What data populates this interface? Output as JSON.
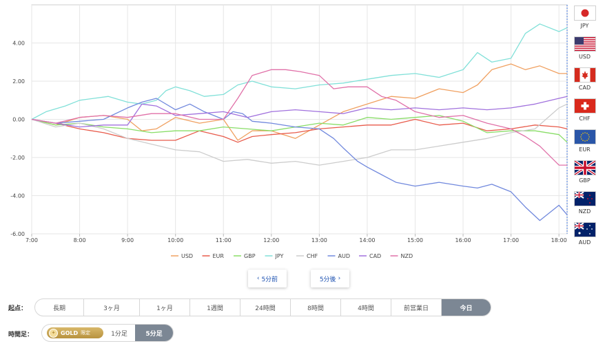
{
  "chart_data": {
    "type": "line",
    "x_ticks": [
      "7:00",
      "8:00",
      "9:00",
      "10:00",
      "11:00",
      "12:00",
      "13:00",
      "14:00",
      "15:00",
      "16:00",
      "17:00",
      "18:00"
    ],
    "y_ticks": [
      "4.00",
      "2.00",
      "0.00",
      "-2.00",
      "-4.00",
      "-6.00"
    ],
    "xlim": [
      7.0,
      18.17
    ],
    "ylim": [
      -6.0,
      6.0
    ],
    "grid": true,
    "legend_position": "bottom",
    "series": [
      {
        "name": "USD",
        "color": "#f0a060",
        "points": [
          [
            7,
            0
          ],
          [
            7.5,
            -0.3
          ],
          [
            8,
            0.1
          ],
          [
            8.5,
            0.2
          ],
          [
            9,
            0
          ],
          [
            9.3,
            -0.6
          ],
          [
            9.6,
            -0.5
          ],
          [
            10,
            0.1
          ],
          [
            10.5,
            -0.2
          ],
          [
            11,
            0
          ],
          [
            11.3,
            -1.1
          ],
          [
            11.6,
            -0.6
          ],
          [
            12,
            -0.6
          ],
          [
            12.5,
            -1.0
          ],
          [
            13,
            -0.3
          ],
          [
            13.5,
            0.4
          ],
          [
            14,
            0.8
          ],
          [
            14.5,
            1.2
          ],
          [
            15,
            1.1
          ],
          [
            15.5,
            1.6
          ],
          [
            16,
            1.4
          ],
          [
            16.3,
            1.8
          ],
          [
            16.6,
            2.6
          ],
          [
            17,
            2.9
          ],
          [
            17.3,
            2.6
          ],
          [
            17.6,
            2.8
          ],
          [
            18,
            2.4
          ],
          [
            18.17,
            2.4
          ]
        ]
      },
      {
        "name": "EUR",
        "color": "#e85a4a",
        "points": [
          [
            7,
            0
          ],
          [
            7.5,
            -0.2
          ],
          [
            8,
            -0.5
          ],
          [
            8.5,
            -0.7
          ],
          [
            9,
            -1.0
          ],
          [
            9.5,
            -1.1
          ],
          [
            10,
            -1.1
          ],
          [
            10.5,
            -0.6
          ],
          [
            11,
            -0.9
          ],
          [
            11.3,
            -1.2
          ],
          [
            11.6,
            -0.9
          ],
          [
            12,
            -0.8
          ],
          [
            12.5,
            -0.7
          ],
          [
            13,
            -0.5
          ],
          [
            13.5,
            -0.4
          ],
          [
            14,
            -0.3
          ],
          [
            14.5,
            -0.3
          ],
          [
            15,
            0
          ],
          [
            15.5,
            -0.3
          ],
          [
            16,
            -0.2
          ],
          [
            16.5,
            -0.6
          ],
          [
            17,
            -0.5
          ],
          [
            17.5,
            -0.3
          ],
          [
            18,
            -0.4
          ],
          [
            18.17,
            -0.5
          ]
        ]
      },
      {
        "name": "GBP",
        "color": "#88dd66",
        "points": [
          [
            7,
            0
          ],
          [
            7.5,
            -0.3
          ],
          [
            8,
            -0.2
          ],
          [
            8.5,
            -0.4
          ],
          [
            9,
            -0.5
          ],
          [
            9.5,
            -0.7
          ],
          [
            10,
            -0.6
          ],
          [
            10.5,
            -0.6
          ],
          [
            11,
            -0.4
          ],
          [
            11.5,
            -0.5
          ],
          [
            12,
            -0.6
          ],
          [
            12.5,
            -0.4
          ],
          [
            13,
            -0.2
          ],
          [
            13.5,
            -0.3
          ],
          [
            14,
            0.1
          ],
          [
            14.5,
            0.0
          ],
          [
            15,
            0.1
          ],
          [
            15.5,
            0.2
          ],
          [
            16,
            -0.1
          ],
          [
            16.5,
            -0.7
          ],
          [
            17,
            -0.6
          ],
          [
            17.5,
            -0.6
          ],
          [
            18,
            -0.8
          ],
          [
            18.17,
            -1.2
          ]
        ]
      },
      {
        "name": "JPY",
        "color": "#80e0d8",
        "points": [
          [
            7,
            0
          ],
          [
            7.3,
            0.4
          ],
          [
            7.7,
            0.7
          ],
          [
            8,
            1.0
          ],
          [
            8.3,
            1.1
          ],
          [
            8.6,
            1.2
          ],
          [
            9,
            0.9
          ],
          [
            9.3,
            0.8
          ],
          [
            9.6,
            1.0
          ],
          [
            9.8,
            1.5
          ],
          [
            10,
            1.7
          ],
          [
            10.3,
            1.5
          ],
          [
            10.6,
            1.2
          ],
          [
            11,
            1.3
          ],
          [
            11.3,
            1.8
          ],
          [
            11.6,
            2.0
          ],
          [
            12,
            1.7
          ],
          [
            12.5,
            1.6
          ],
          [
            13,
            1.8
          ],
          [
            13.5,
            1.9
          ],
          [
            14,
            2.1
          ],
          [
            14.5,
            2.3
          ],
          [
            15,
            2.4
          ],
          [
            15.5,
            2.2
          ],
          [
            16,
            2.6
          ],
          [
            16.3,
            3.5
          ],
          [
            16.6,
            3.0
          ],
          [
            17,
            3.2
          ],
          [
            17.3,
            4.5
          ],
          [
            17.6,
            5.0
          ],
          [
            18,
            4.6
          ],
          [
            18.17,
            4.8
          ]
        ]
      },
      {
        "name": "CHF",
        "color": "#cccccc",
        "points": [
          [
            7,
            0
          ],
          [
            7.5,
            -0.4
          ],
          [
            8,
            -0.2
          ],
          [
            8.5,
            -0.5
          ],
          [
            9,
            -1.0
          ],
          [
            9.5,
            -1.3
          ],
          [
            10,
            -1.6
          ],
          [
            10.5,
            -1.7
          ],
          [
            11,
            -2.2
          ],
          [
            11.5,
            -2.1
          ],
          [
            12,
            -2.3
          ],
          [
            12.5,
            -2.2
          ],
          [
            13,
            -2.4
          ],
          [
            13.5,
            -2.2
          ],
          [
            14,
            -2.0
          ],
          [
            14.5,
            -1.6
          ],
          [
            15,
            -1.6
          ],
          [
            15.5,
            -1.4
          ],
          [
            16,
            -1.2
          ],
          [
            16.5,
            -1.0
          ],
          [
            17,
            -0.7
          ],
          [
            17.5,
            -0.5
          ],
          [
            18,
            0.6
          ],
          [
            18.17,
            0.8
          ]
        ]
      },
      {
        "name": "AUD",
        "color": "#7088dd",
        "points": [
          [
            7,
            0
          ],
          [
            7.5,
            -0.2
          ],
          [
            8,
            -0.1
          ],
          [
            8.5,
            0
          ],
          [
            9,
            0.6
          ],
          [
            9.3,
            0.9
          ],
          [
            9.6,
            1.1
          ],
          [
            10,
            0.5
          ],
          [
            10.3,
            0.8
          ],
          [
            10.6,
            0.4
          ],
          [
            11,
            0
          ],
          [
            11.2,
            0.4
          ],
          [
            11.4,
            0.3
          ],
          [
            11.6,
            -0.1
          ],
          [
            12,
            -0.2
          ],
          [
            12.5,
            -0.4
          ],
          [
            13,
            -0.5
          ],
          [
            13.3,
            -1.0
          ],
          [
            13.5,
            -1.5
          ],
          [
            13.8,
            -2.2
          ],
          [
            14,
            -2.5
          ],
          [
            14.3,
            -2.9
          ],
          [
            14.6,
            -3.3
          ],
          [
            15,
            -3.5
          ],
          [
            15.5,
            -3.3
          ],
          [
            16,
            -3.5
          ],
          [
            16.3,
            -3.6
          ],
          [
            16.6,
            -3.4
          ],
          [
            17,
            -3.8
          ],
          [
            17.3,
            -4.6
          ],
          [
            17.6,
            -5.3
          ],
          [
            18,
            -4.5
          ],
          [
            18.17,
            -5.0
          ]
        ]
      },
      {
        "name": "CAD",
        "color": "#a070dd",
        "points": [
          [
            7,
            0
          ],
          [
            7.5,
            -0.2
          ],
          [
            8,
            -0.4
          ],
          [
            8.5,
            -0.3
          ],
          [
            9,
            -0.3
          ],
          [
            9.3,
            0.8
          ],
          [
            9.6,
            0.7
          ],
          [
            10,
            0.2
          ],
          [
            10.5,
            0.3
          ],
          [
            11,
            0.4
          ],
          [
            11.5,
            0.1
          ],
          [
            12,
            0.4
          ],
          [
            12.5,
            0.5
          ],
          [
            13,
            0.4
          ],
          [
            13.5,
            0.3
          ],
          [
            14,
            0.6
          ],
          [
            14.5,
            0.5
          ],
          [
            15,
            0.6
          ],
          [
            15.5,
            0.5
          ],
          [
            16,
            0.6
          ],
          [
            16.5,
            0.5
          ],
          [
            17,
            0.6
          ],
          [
            17.5,
            0.8
          ],
          [
            18,
            1.1
          ],
          [
            18.17,
            1.2
          ]
        ]
      },
      {
        "name": "NZD",
        "color": "#e070a8",
        "points": [
          [
            7,
            0
          ],
          [
            7.5,
            -0.2
          ],
          [
            8,
            0.1
          ],
          [
            8.5,
            0.2
          ],
          [
            9,
            0.1
          ],
          [
            9.5,
            0.3
          ],
          [
            10,
            0.3
          ],
          [
            10.5,
            0.0
          ],
          [
            11,
            0.0
          ],
          [
            11.3,
            1.1
          ],
          [
            11.6,
            2.3
          ],
          [
            12,
            2.6
          ],
          [
            12.3,
            2.6
          ],
          [
            12.6,
            2.5
          ],
          [
            13,
            2.3
          ],
          [
            13.3,
            1.6
          ],
          [
            13.6,
            1.7
          ],
          [
            14,
            1.7
          ],
          [
            14.3,
            1.2
          ],
          [
            14.6,
            1.0
          ],
          [
            15,
            0.4
          ],
          [
            15.5,
            0.1
          ],
          [
            16,
            0.2
          ],
          [
            16.5,
            -0.2
          ],
          [
            17,
            -0.5
          ],
          [
            17.3,
            -0.9
          ],
          [
            17.6,
            -1.4
          ],
          [
            18,
            -2.4
          ],
          [
            18.17,
            -2.4
          ]
        ]
      }
    ]
  },
  "flags": [
    {
      "code": "JPY",
      "icon": "japan-flag-icon"
    },
    {
      "code": "USD",
      "icon": "usa-flag-icon"
    },
    {
      "code": "CAD",
      "icon": "canada-flag-icon"
    },
    {
      "code": "CHF",
      "icon": "switzerland-flag-icon"
    },
    {
      "code": "EUR",
      "icon": "eu-flag-icon"
    },
    {
      "code": "GBP",
      "icon": "uk-flag-icon"
    },
    {
      "code": "NZD",
      "icon": "new-zealand-flag-icon"
    },
    {
      "code": "AUD",
      "icon": "australia-flag-icon"
    }
  ],
  "nav": {
    "prev": "5分前",
    "next": "5分後"
  },
  "start_point": {
    "label": "起点：",
    "options": [
      "長期",
      "3ヶ月",
      "1ヶ月",
      "1週間",
      "24時間",
      "8時間",
      "4時間",
      "前営業日",
      "今日"
    ],
    "selected": "今日"
  },
  "timeframe": {
    "label": "時間足：",
    "gold_text": "GOLD",
    "gold_limited": "限定",
    "option1": "1分足",
    "option5": "5分足",
    "selected": "5分足"
  },
  "colors": {
    "active_bg": "#7c8794",
    "nav_text": "#1a4fb0",
    "gold": "#c9a455"
  }
}
